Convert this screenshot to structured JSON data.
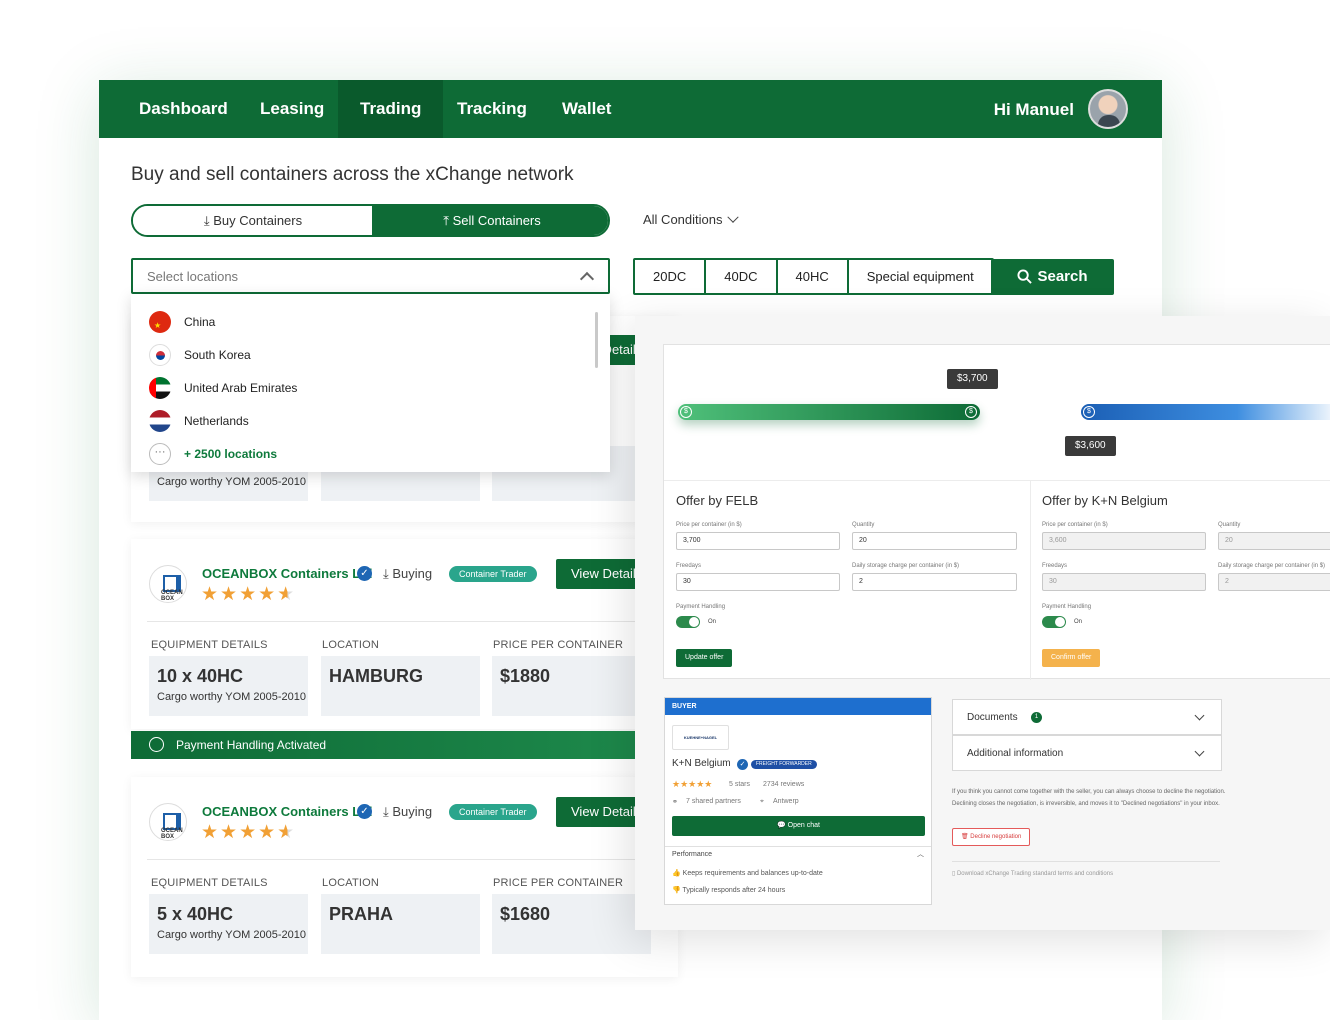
{
  "nav": {
    "items": [
      "Dashboard",
      "Leasing",
      "Trading",
      "Tracking",
      "Wallet"
    ],
    "active": "Trading",
    "greeting": "Hi Manuel"
  },
  "page": {
    "title": "Buy and sell containers across the xChange network",
    "buy_label": "Buy Containers",
    "sell_label": "Sell Containers",
    "conditions_label": "All Conditions",
    "location_placeholder": "Select locations",
    "filters": [
      "20DC",
      "40DC",
      "40HC",
      "Special equipment"
    ],
    "search_label": "Search"
  },
  "locations": {
    "items": [
      "China",
      "South Korea",
      "United Arab Emirates",
      "Netherlands"
    ],
    "more": "+ 2500 locations",
    "more_icon": "···"
  },
  "listings": {
    "partial_text": "Cargo worthy YOM 2005-2010",
    "view_label": "View Details",
    "payment_label": "Payment Handling Activated",
    "col_equipment": "EQUIPMENT DETAILS",
    "col_location": "LOCATION",
    "col_price": "PRICE PER CONTAINER",
    "cards": [
      {
        "company": "OCEANBOX Containers Ltd",
        "logo_text": "OCEAN BOX",
        "action": "Buying",
        "badge": "Container Trader",
        "rating": 4.5,
        "equipment": "10 x 40HC",
        "condition": "Cargo worthy YOM 2005-2010",
        "location": "HAMBURG",
        "price": "$1880"
      },
      {
        "company": "OCEANBOX Containers Ltd",
        "logo_text": "OCEAN BOX",
        "action": "Buying",
        "badge": "Container Trader",
        "rating": 4.5,
        "equipment": "5 x 40HC",
        "condition": "Cargo worthy YOM 2005-2010",
        "location": "PRAHA",
        "price": "$1680"
      }
    ]
  },
  "negotiation": {
    "tag_high": "$3,700",
    "tag_low": "$3,600",
    "felb": {
      "title": "Offer by FELB",
      "price_label": "Price per container (in $)",
      "price": "3,700",
      "qty_label": "Quantity",
      "qty": "20",
      "freedays_label": "Freedays",
      "freedays": "30",
      "storage_label": "Daily storage charge per container (in $)",
      "storage": "2",
      "payment_label": "Payment Handling",
      "payment_state": "On",
      "button": "Update offer"
    },
    "kn": {
      "title": "Offer by K+N Belgium",
      "price_label": "Price per container (in $)",
      "price": "3,600",
      "qty_label": "Quantity",
      "qty": "20",
      "freedays_label": "Freedays",
      "freedays": "30",
      "storage_label": "Daily storage charge per container (in $)",
      "storage": "2",
      "payment_label": "Payment Handling",
      "payment_state": "On",
      "button": "Confirm offer"
    }
  },
  "buyer": {
    "header": "BUYER",
    "logo_text": "KUEHNE+NAGEL",
    "name": "K+N Belgium",
    "badge": "FREIGHT FORWARDER",
    "stars_text": "5 stars",
    "reviews": "2734 reviews",
    "partners": "7 shared partners",
    "city": "Antwerp",
    "chat": "Open chat",
    "performance_title": "Performance",
    "perf_1": "Keeps requirements and balances up-to-date",
    "perf_2": "Typically responds after 24 hours"
  },
  "sidepanel": {
    "documents": "Documents",
    "documents_count": "1",
    "additional": "Additional information",
    "info": "If you think you cannot come together with the seller, you can always choose to decline the negotiation. Declining closes the negotiation, is irreversible, and moves it to \"Declined negotiations\" in your inbox.",
    "decline": "Decline negotiation",
    "terms": "Download xChange Trading standard terms and conditions"
  },
  "colors": {
    "brand": "#0e6b36",
    "accent_blue": "#1e6fcf",
    "star": "#f1a035",
    "badge": "#2aa58c"
  }
}
